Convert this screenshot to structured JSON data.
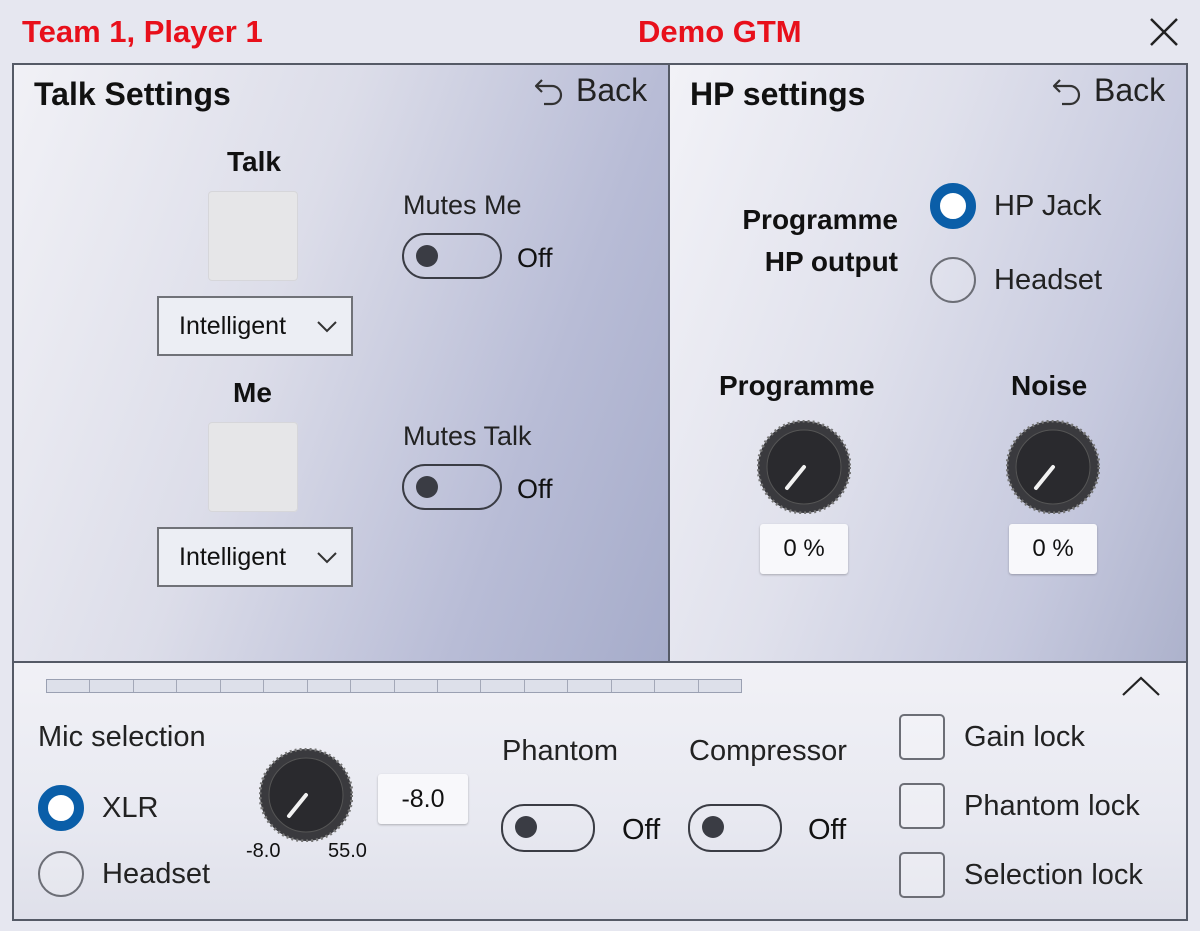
{
  "header": {
    "player": "Team 1, Player 1",
    "app": "Demo GTM",
    "close_icon": "close-icon"
  },
  "talk_panel": {
    "title": "Talk Settings",
    "back_label": "Back",
    "talk": {
      "label": "Talk",
      "mode": "Intelligent",
      "toggle_label": "Mutes Me",
      "toggle_state": "Off"
    },
    "me": {
      "label": "Me",
      "mode": "Intelligent",
      "toggle_label": "Mutes Talk",
      "toggle_state": "Off"
    }
  },
  "hp_panel": {
    "title": "HP settings",
    "back_label": "Back",
    "output_label_line1": "Programme",
    "output_label_line2": "HP output",
    "options": [
      "HP Jack",
      "Headset"
    ],
    "selected": "HP Jack",
    "programme": {
      "label": "Programme",
      "value": "0 %"
    },
    "noise": {
      "label": "Noise",
      "value": "0 %"
    }
  },
  "bottom_panel": {
    "meter_segments": 16,
    "collapse_icon": "chevron-up-icon",
    "mic_selection_label": "Mic selection",
    "mic_options": [
      "XLR",
      "Headset"
    ],
    "mic_selected": "XLR",
    "gain": {
      "value": "-8.0",
      "min_label": "-8.0",
      "max_label": "55.0"
    },
    "phantom": {
      "label": "Phantom",
      "state": "Off"
    },
    "compressor": {
      "label": "Compressor",
      "state": "Off"
    },
    "locks": [
      {
        "label": "Gain lock",
        "checked": false
      },
      {
        "label": "Phantom lock",
        "checked": false
      },
      {
        "label": "Selection lock",
        "checked": false
      }
    ]
  },
  "colors": {
    "title_red": "#e8101b",
    "radio_blue": "#0a5ea8",
    "panel_border": "#555a66"
  }
}
